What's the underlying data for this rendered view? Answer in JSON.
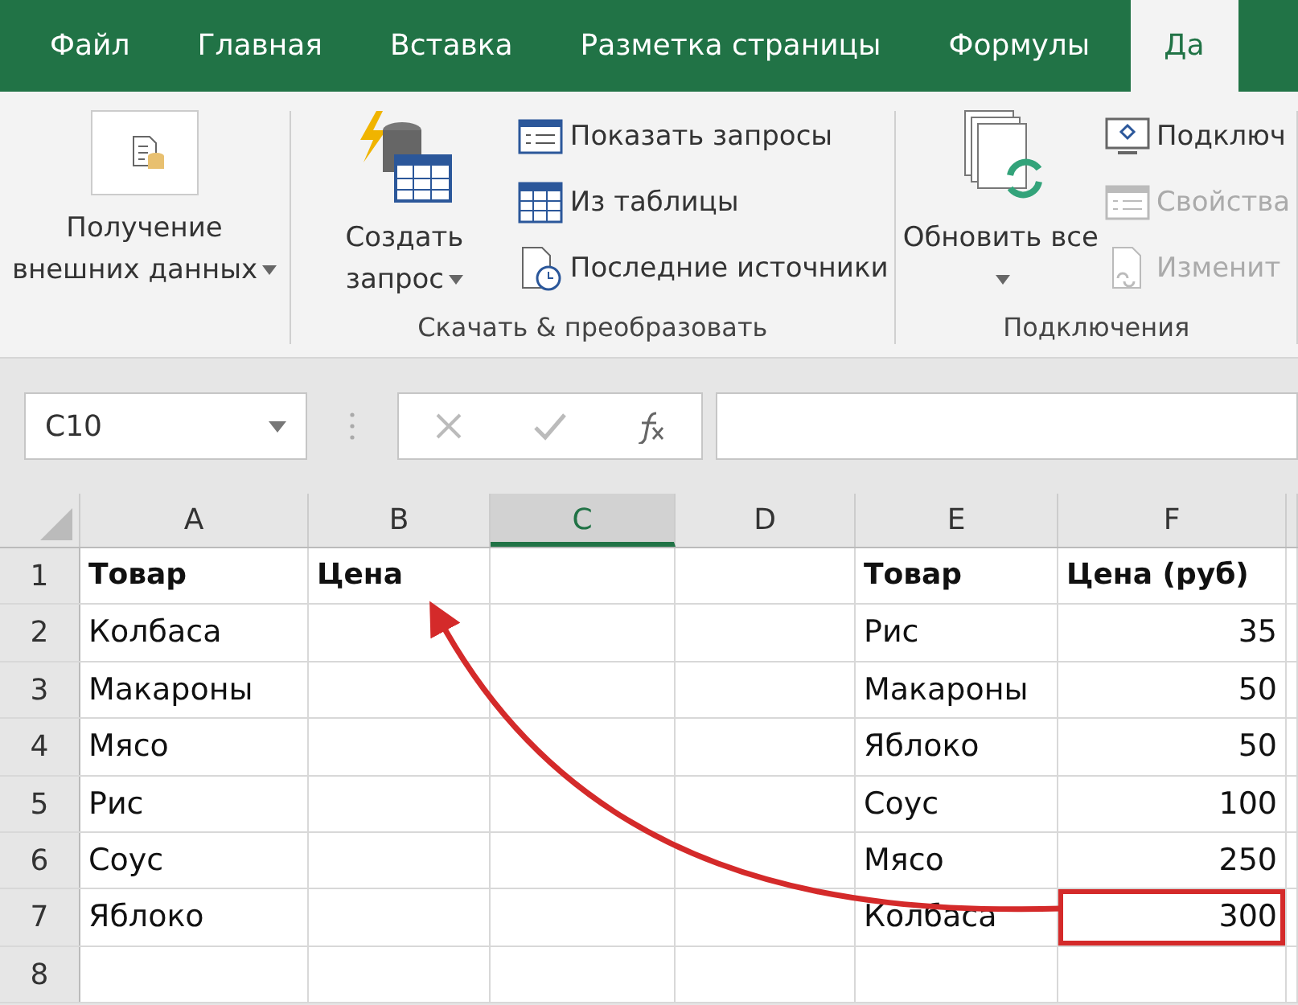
{
  "tabs": [
    {
      "label": "Файл",
      "selected": false
    },
    {
      "label": "Главная",
      "selected": false
    },
    {
      "label": "Вставка",
      "selected": false
    },
    {
      "label": "Разметка страницы",
      "selected": false
    },
    {
      "label": "Формулы",
      "selected": false
    },
    {
      "label": "Да",
      "selected": true
    }
  ],
  "ribbon": {
    "groups": [
      {
        "items": [
          {
            "kind": "large",
            "label": "Получение внешних данных",
            "dropdown": true,
            "disabled": false
          }
        ]
      },
      {
        "label": "Скачать & преобразовать",
        "items": [
          {
            "kind": "large",
            "label": "Создать запрос",
            "dropdown": true,
            "disabled": false
          },
          {
            "kind": "small",
            "label": "Показать запросы",
            "disabled": false
          },
          {
            "kind": "small",
            "label": "Из таблицы",
            "disabled": false
          },
          {
            "kind": "small",
            "label": "Последние источники",
            "disabled": false
          }
        ]
      },
      {
        "label": "Подключения",
        "items": [
          {
            "kind": "large",
            "label": "Обновить все",
            "dropdown": true,
            "disabled": false
          },
          {
            "kind": "small",
            "label": "Подключ",
            "disabled": false
          },
          {
            "kind": "small",
            "label": "Свойства",
            "disabled": true
          },
          {
            "kind": "small",
            "label": "Изменит",
            "disabled": true
          }
        ]
      }
    ]
  },
  "name_box": {
    "value": "C10"
  },
  "columns": [
    {
      "label": "A",
      "selected": false
    },
    {
      "label": "B",
      "selected": false
    },
    {
      "label": "C",
      "selected": true
    },
    {
      "label": "D",
      "selected": false
    },
    {
      "label": "E",
      "selected": false
    },
    {
      "label": "F",
      "selected": false
    }
  ],
  "rows": [
    {
      "num": "1",
      "kind": "header",
      "cells": [
        {
          "text": "Товар"
        },
        {
          "text": "Цена"
        },
        null,
        null,
        {
          "text": "Товар"
        },
        {
          "text": "Цена (руб)"
        }
      ]
    },
    {
      "num": "2",
      "cells": [
        {
          "text": "Колбаса"
        },
        null,
        null,
        null,
        {
          "text": "Рис"
        },
        {
          "text": "35",
          "kind": "number"
        }
      ]
    },
    {
      "num": "3",
      "cells": [
        {
          "text": "Макароны"
        },
        null,
        null,
        null,
        {
          "text": "Макароны"
        },
        {
          "text": "50",
          "kind": "number"
        }
      ]
    },
    {
      "num": "4",
      "cells": [
        {
          "text": "Мясо"
        },
        null,
        null,
        null,
        {
          "text": "Яблоко"
        },
        {
          "text": "50",
          "kind": "number"
        }
      ]
    },
    {
      "num": "5",
      "cells": [
        {
          "text": "Рис"
        },
        null,
        null,
        null,
        {
          "text": "Соус"
        },
        {
          "text": "100",
          "kind": "number"
        }
      ]
    },
    {
      "num": "6",
      "cells": [
        {
          "text": "Соус"
        },
        null,
        null,
        null,
        {
          "text": "Мясо"
        },
        {
          "text": "250",
          "kind": "number"
        }
      ]
    },
    {
      "num": "7",
      "cells": [
        {
          "text": "Яблоко"
        },
        null,
        null,
        null,
        {
          "text": "Колбаса"
        },
        {
          "text": "300",
          "kind": "number",
          "highlighted": true
        }
      ]
    },
    {
      "num": "8"
    }
  ]
}
